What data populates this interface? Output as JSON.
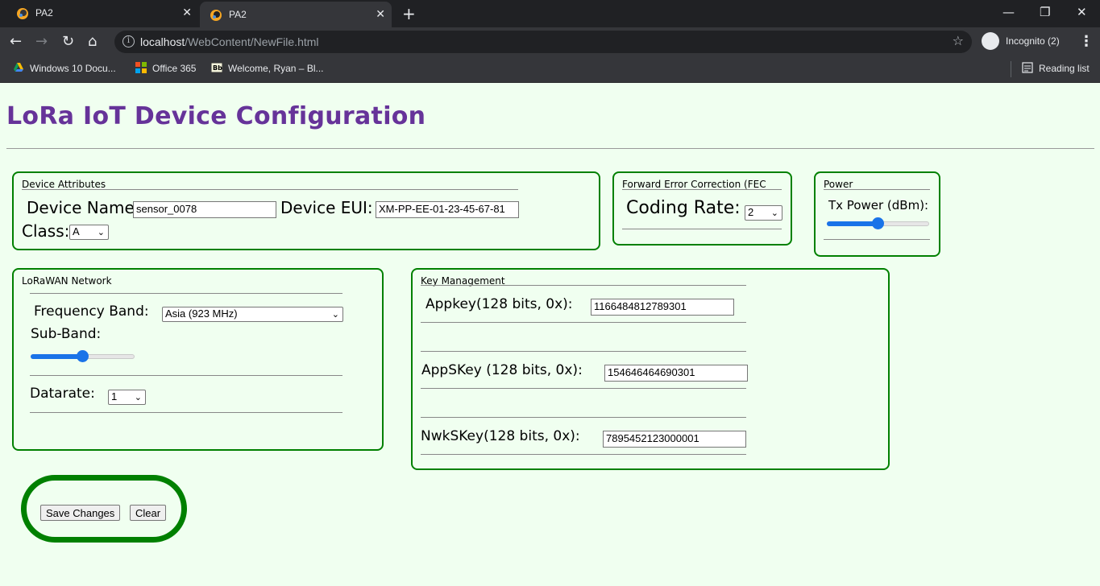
{
  "browser": {
    "tabs": [
      {
        "title": "PA2",
        "active": false
      },
      {
        "title": "PA2",
        "active": true
      }
    ],
    "url_host": "localhost",
    "url_path": "/WebContent/NewFile.html",
    "incognito_label": "Incognito (2)",
    "bookmarks": [
      {
        "label": "Windows 10 Docu...",
        "icon": "google-drive-icon"
      },
      {
        "label": "Office 365",
        "icon": "office-365-icon"
      },
      {
        "label": "Welcome, Ryan – Bl...",
        "icon": "blackboard-icon"
      }
    ],
    "reading_list": "Reading list"
  },
  "page": {
    "title": "LoRa IoT Device Configuration",
    "device_attributes": {
      "legend": "Device Attributes",
      "device_name_label": "Device Name:",
      "device_name_value": "sensor_0078",
      "device_eui_label": "Device EUI:",
      "device_eui_value": "XM-PP-EE-01-23-45-67-81",
      "class_label": "Class:",
      "class_value": "A"
    },
    "fec": {
      "legend": "Forward Error Correction (FEC",
      "coding_rate_label": "Coding Rate:",
      "coding_rate_value": "2"
    },
    "power": {
      "legend": "Power",
      "tx_power_label": "Tx Power (dBm):",
      "tx_power_level": 0.5
    },
    "network": {
      "legend": "LoRaWAN Network",
      "frequency_band_label": "Frequency Band:",
      "frequency_band_value": "Asia (923 MHz)",
      "sub_band_label": "Sub-Band:",
      "sub_band_level": 0.5,
      "datarate_label": "Datarate:",
      "datarate_value": "1"
    },
    "keys": {
      "legend": "Key Management",
      "appkey_label": "Appkey(128 bits, 0x):",
      "appkey_value": "1166484812789301",
      "appskey_label": "AppSKey (128 bits, 0x):",
      "appskey_value": "154646464690301",
      "nwkskey_label": "NwkSKey(128 bits, 0x):",
      "nwkskey_value": "7895452123000001"
    },
    "buttons": {
      "save": "Save Changes",
      "clear": "Clear"
    },
    "colors": {
      "title": "#663399",
      "border": "#008000",
      "background": "#f0fff0",
      "slider": "#1a73e8"
    }
  }
}
